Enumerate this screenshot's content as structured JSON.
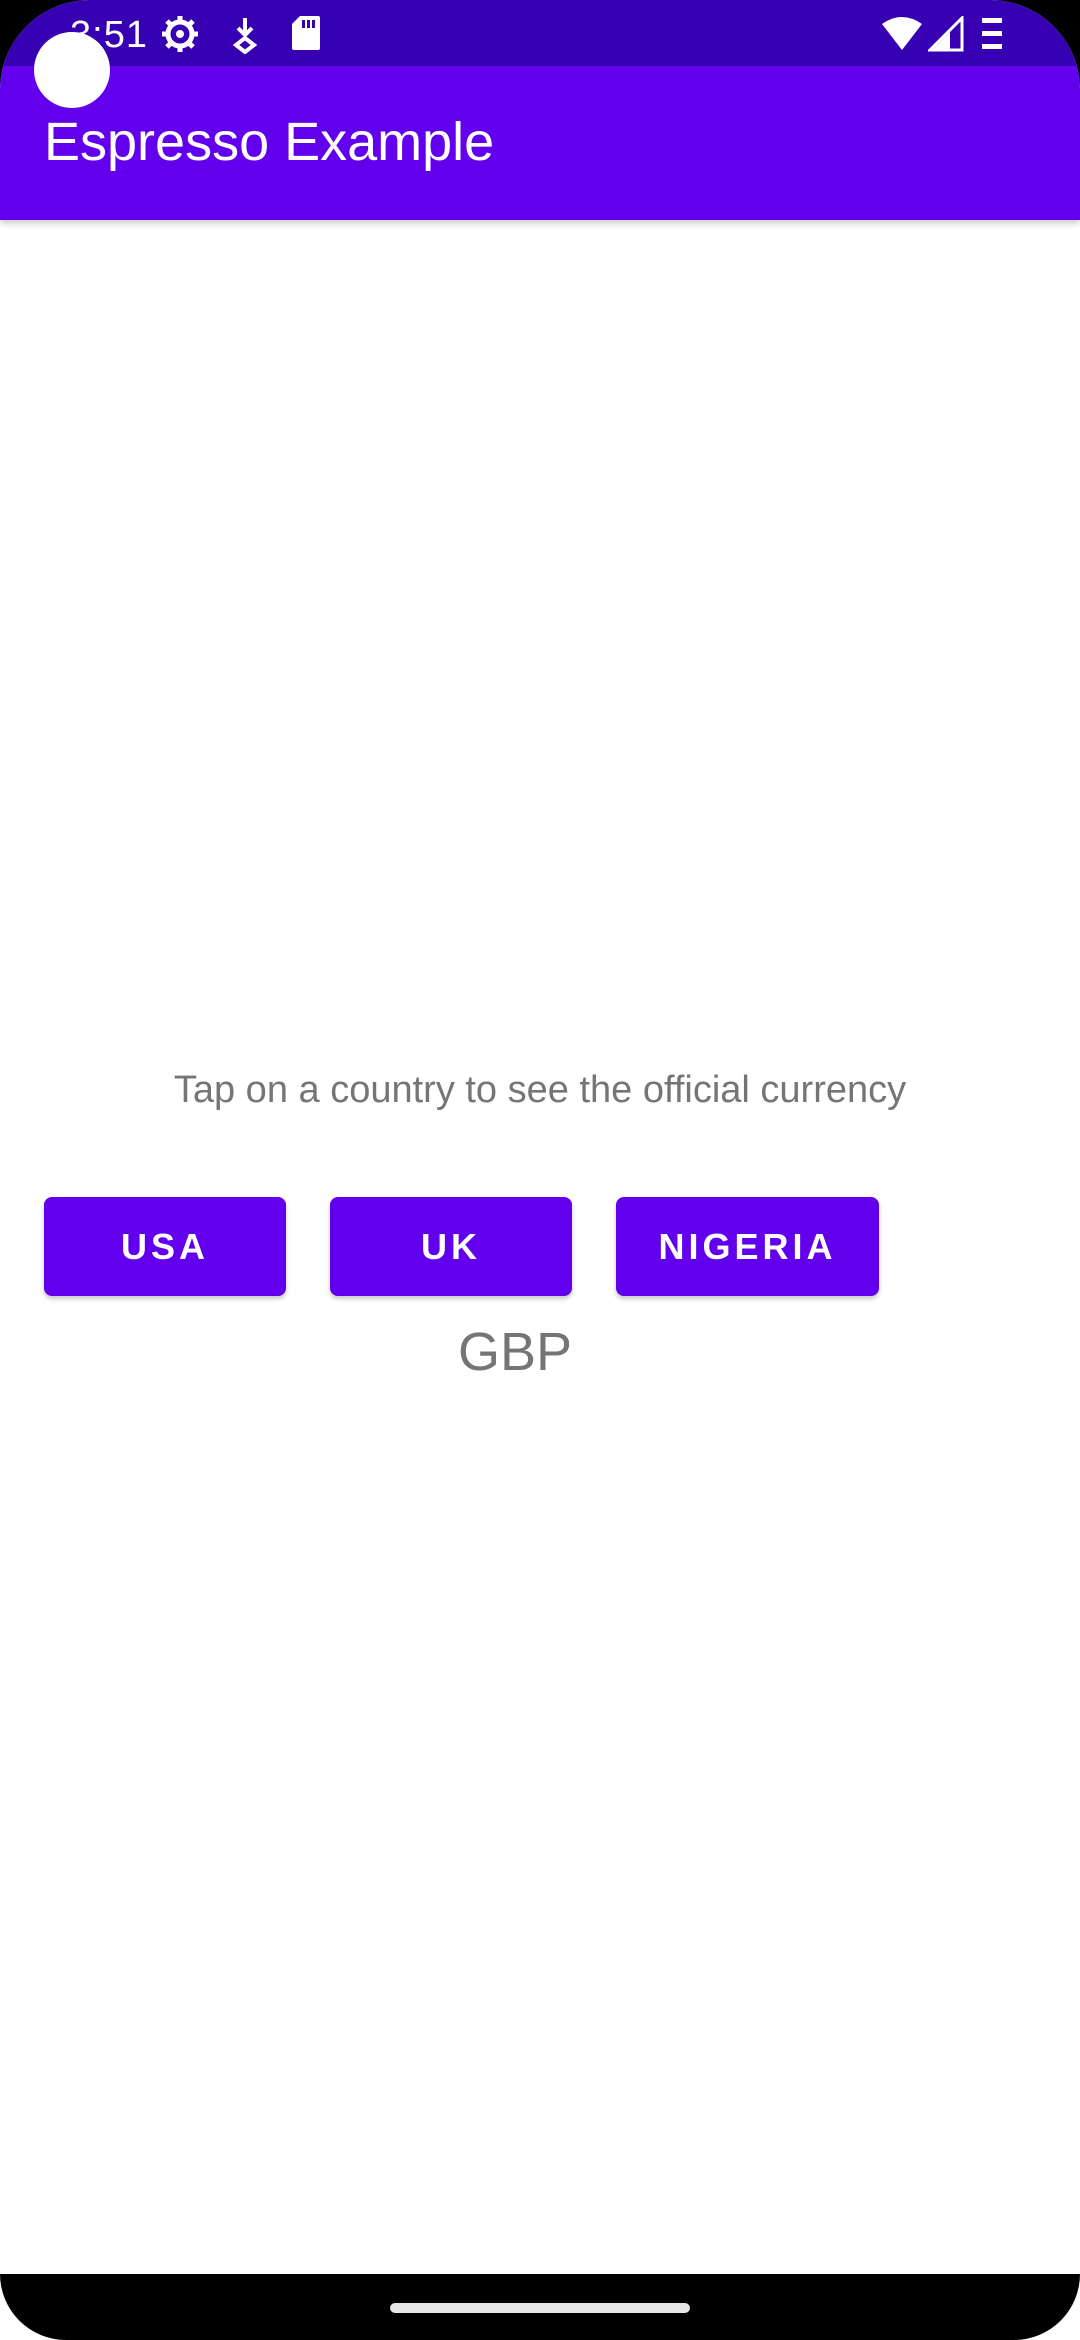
{
  "status_bar": {
    "time": "3:51",
    "icons": [
      "settings-gear-icon",
      "download-icon",
      "sd-card-icon",
      "wifi-icon",
      "signal-icon",
      "more-icon"
    ]
  },
  "app_bar": {
    "title": "Espresso Example"
  },
  "main": {
    "instruction": "Tap on a country to see the official currency",
    "buttons": [
      {
        "label": "USA"
      },
      {
        "label": "UK"
      },
      {
        "label": "NIGERIA"
      }
    ],
    "currency": "GBP"
  },
  "colors": {
    "status_bar": "#3700b3",
    "primary": "#6200ee",
    "text_secondary": "#757575"
  }
}
